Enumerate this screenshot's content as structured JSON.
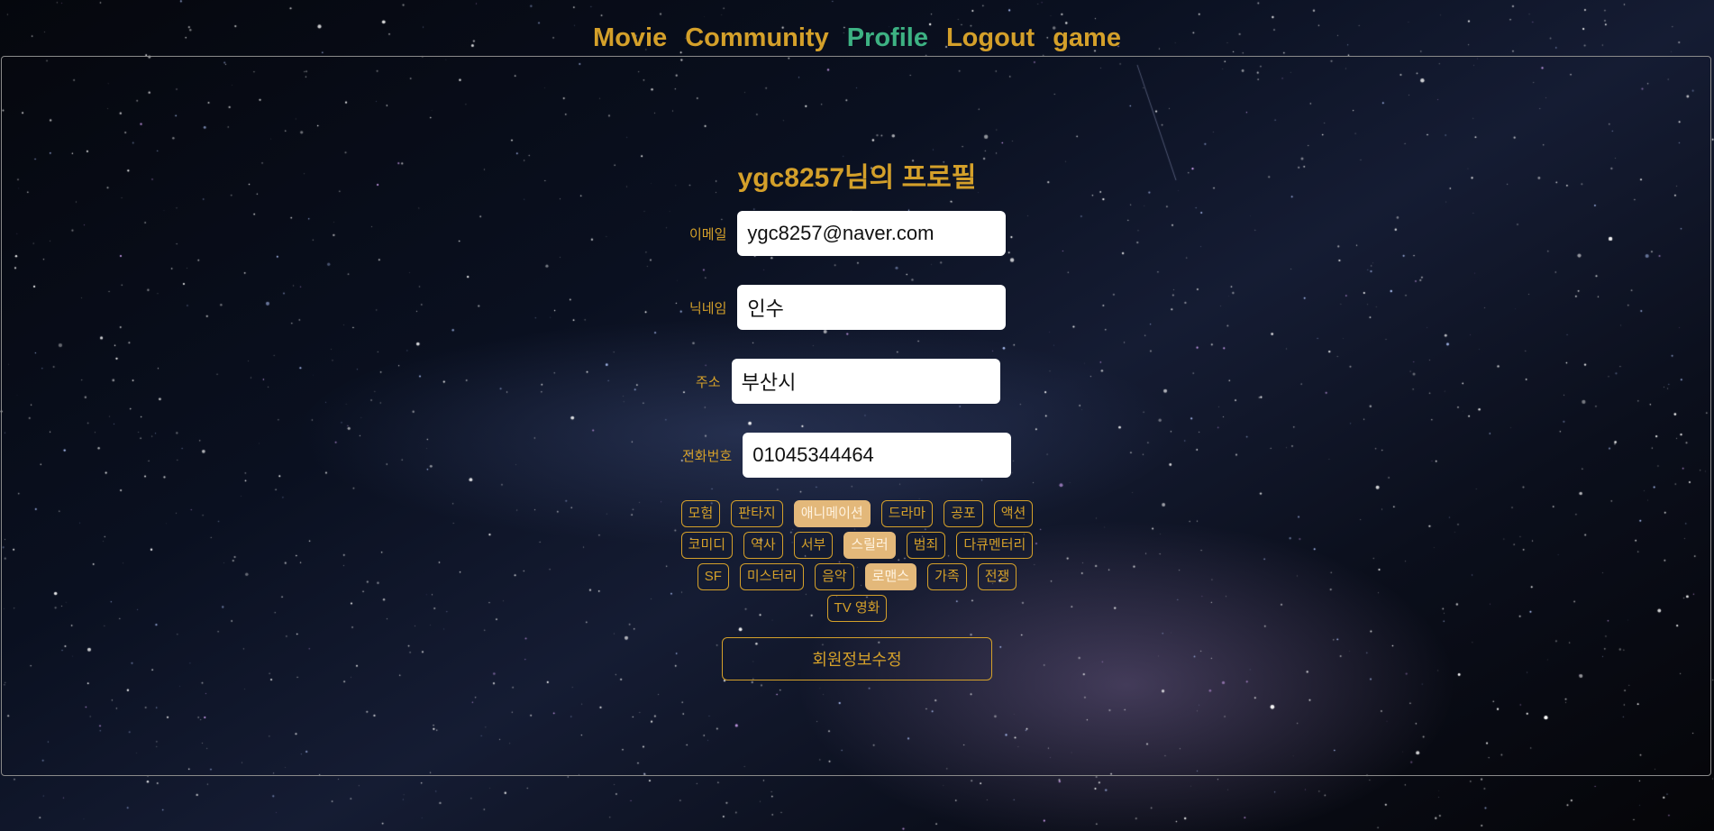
{
  "nav": {
    "items": [
      {
        "label": "Movie"
      },
      {
        "label": "Community"
      },
      {
        "label": "Profile"
      },
      {
        "label": "Logout"
      },
      {
        "label": "game"
      }
    ],
    "active": "Profile"
  },
  "profile": {
    "title": "ygc8257님의 프로필",
    "fields": [
      {
        "label": "이메일",
        "value": "ygc8257@naver.com"
      },
      {
        "label": "닉네임",
        "value": "인수"
      },
      {
        "label": "주소",
        "value": "부산시"
      },
      {
        "label": "전화번호",
        "value": "01045344464"
      }
    ],
    "genres": [
      {
        "label": "모험",
        "selected": false
      },
      {
        "label": "판타지",
        "selected": false
      },
      {
        "label": "애니메이션",
        "selected": true
      },
      {
        "label": "드라마",
        "selected": false
      },
      {
        "label": "공포",
        "selected": false
      },
      {
        "label": "액션",
        "selected": false
      },
      {
        "label": "코미디",
        "selected": false
      },
      {
        "label": "역사",
        "selected": false
      },
      {
        "label": "서부",
        "selected": false
      },
      {
        "label": "스릴러",
        "selected": true
      },
      {
        "label": "범죄",
        "selected": false
      },
      {
        "label": "다큐멘터리",
        "selected": false
      },
      {
        "label": "SF",
        "selected": false
      },
      {
        "label": "미스터리",
        "selected": false
      },
      {
        "label": "음악",
        "selected": false
      },
      {
        "label": "로맨스",
        "selected": true
      },
      {
        "label": "가족",
        "selected": false
      },
      {
        "label": "전쟁",
        "selected": false
      },
      {
        "label": "TV 영화",
        "selected": false
      }
    ],
    "submit_label": "회원정보수정"
  },
  "colors": {
    "accent": "#d4a02a",
    "active_nav": "#3db283",
    "selected_genre": "#e3b87a"
  }
}
